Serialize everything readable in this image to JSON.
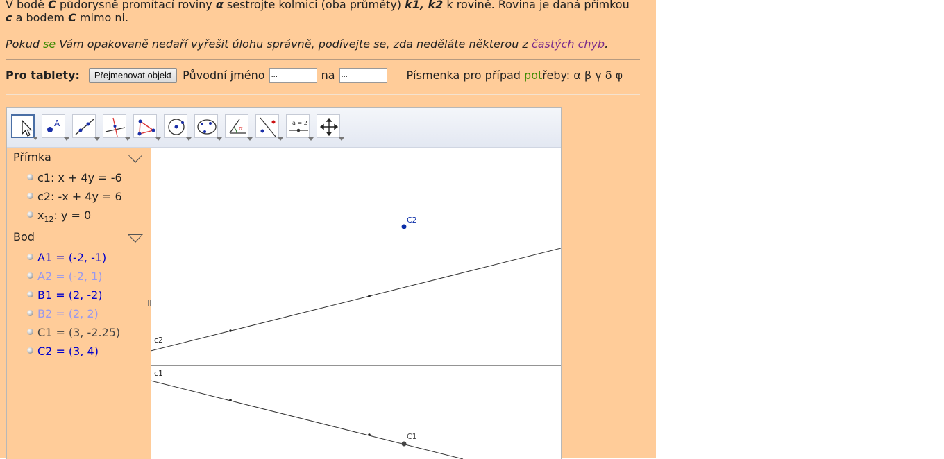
{
  "task": {
    "t1": "V bodě ",
    "C": "C",
    "t2": " půdorysně promítací roviny ",
    "alpha": "α",
    "t3": " sestrojte kolmici (oba průměty) ",
    "k": "k1, k2",
    "t4": " k rovině. Rovina je daná přímkou ",
    "c": "c",
    "t5": " a bodem ",
    "C2": "C",
    "t6": " mimo ni."
  },
  "hint": {
    "t1": "Pokud ",
    "se": "se",
    "t2": " Vám opakovaně nedaří vyřešit úlohu správně, podívejte se, zda neděláte některou z ",
    "link": "častých chyb",
    "t3": "."
  },
  "tablet": {
    "label": "Pro tablety:",
    "button": "Přejmenovat objekt",
    "orig_label": "Původní jméno",
    "orig_value": "...",
    "na_label": "na",
    "new_value": "...",
    "greek_pre": "Písmenka pro případ ",
    "greek_pot": "pot",
    "greek_post": "řeby: α β γ δ φ"
  },
  "toolbar": {
    "tools": [
      "move-tool",
      "point-tool",
      "line-tool",
      "perpendicular-line-tool",
      "polygon-tool",
      "circle-tool",
      "conic-tool",
      "angle-tool",
      "reflect-tool",
      "slider-tool",
      "move-graphics-tool"
    ],
    "slider_label": "a = 2"
  },
  "algebra": {
    "groups": [
      {
        "title": "Přímka",
        "items": [
          {
            "text": "c1: x + 4y = -6"
          },
          {
            "text": "c2: -x + 4y = 6"
          },
          {
            "name": "x",
            "sub": "12",
            "rest": ": y = 0"
          }
        ]
      },
      {
        "title": "Bod",
        "items": [
          {
            "text": "A1 = (-2, -1)",
            "color": "#0000cc"
          },
          {
            "text": "A2 = (-2, 1)",
            "color": "#9999ee"
          },
          {
            "text": "B1 = (2, -2)",
            "color": "#0000cc"
          },
          {
            "text": "B2 = (2, 2)",
            "color": "#9999ee"
          },
          {
            "text": "C1 = (3, -2.25)",
            "color": "#444444"
          },
          {
            "text": "C2 = (3, 4)",
            "color": "#0000cc"
          }
        ]
      }
    ]
  },
  "canvas": {
    "labels": {
      "c2": "c2",
      "c1": "c1",
      "C2": "C2",
      "C1": "C1"
    },
    "colors": {
      "point_blue": "#0b2ea8",
      "point_gray": "#444444",
      "line": "#333333"
    }
  }
}
